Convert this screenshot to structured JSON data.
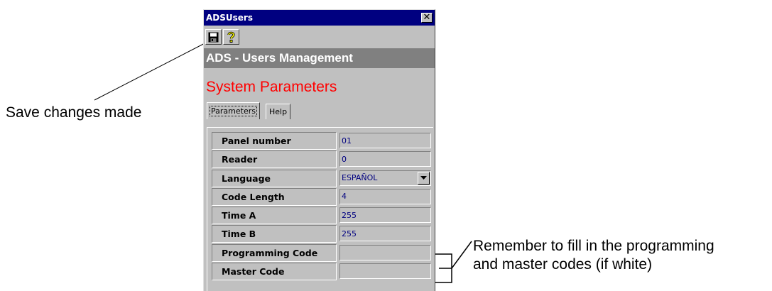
{
  "window": {
    "title": "ADSUsers",
    "close_glyph": "✕"
  },
  "toolbar": {
    "save_icon": "floppy-disk-icon",
    "help_icon": "question-mark-icon"
  },
  "header": {
    "title": "ADS - Users Management"
  },
  "section": {
    "title": "System Parameters",
    "color": "#ff0000"
  },
  "tabs": [
    {
      "label": "Parameters",
      "selected": true
    },
    {
      "label": "Help",
      "selected": false
    }
  ],
  "fields": [
    {
      "label": "Panel number",
      "value": "01"
    },
    {
      "label": "Reader",
      "value": "0"
    },
    {
      "label": "Language",
      "value": "ESPAÑOL"
    },
    {
      "label": "Code Length",
      "value": "4"
    },
    {
      "label": "Time A",
      "value": "255"
    },
    {
      "label": "Time B",
      "value": "255"
    },
    {
      "label": "Programming Code",
      "value": ""
    },
    {
      "label": "Master Code",
      "value": ""
    }
  ],
  "callouts": {
    "save": "Save changes made",
    "codes_line1": "Remember to fill in the programming",
    "codes_line2": "and master codes (if white)"
  },
  "colors": {
    "titlebar": "#000080",
    "face": "#c0c0c0",
    "header_band": "#808080",
    "field_text": "#000080"
  }
}
